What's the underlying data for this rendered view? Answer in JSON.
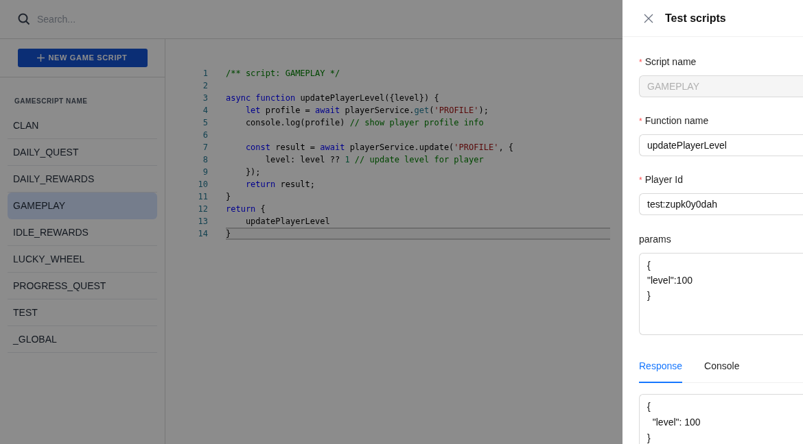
{
  "search": {
    "placeholder": "Search..."
  },
  "sidebar": {
    "new_button": "NEW GAME SCRIPT",
    "heading": "GAMESCRIPT NAME",
    "items": [
      {
        "label": "CLAN",
        "selected": false
      },
      {
        "label": "DAILY_QUEST",
        "selected": false
      },
      {
        "label": "DAILY_REWARDS",
        "selected": false
      },
      {
        "label": "GAMEPLAY",
        "selected": true
      },
      {
        "label": "IDLE_REWARDS",
        "selected": false
      },
      {
        "label": "LUCKY_WHEEL",
        "selected": false
      },
      {
        "label": "PROGRESS_QUEST",
        "selected": false
      },
      {
        "label": "TEST",
        "selected": false
      },
      {
        "label": "_GLOBAL",
        "selected": false
      }
    ]
  },
  "editor": {
    "lines": [
      {
        "number": "1",
        "current": false,
        "tokens": [
          {
            "text": "/** script: GAMEPLAY */",
            "kind": "comment"
          }
        ]
      },
      {
        "number": "2",
        "current": false
      },
      {
        "number": "3",
        "current": false,
        "tokens": [
          {
            "text": "async function",
            "kind": "keyword"
          },
          {
            "text": " updatePlayerLevel({level}) {",
            "kind": "plain"
          }
        ]
      },
      {
        "number": "4",
        "current": false,
        "tokens": [
          {
            "text": "    let",
            "kind": "keyword"
          },
          {
            "text": " profile = ",
            "kind": "plain"
          },
          {
            "text": "await",
            "kind": "keyword"
          },
          {
            "text": " playerService.",
            "kind": "plain"
          },
          {
            "text": "get",
            "kind": "method"
          },
          {
            "text": "(",
            "kind": "plain"
          },
          {
            "text": "'PROFILE'",
            "kind": "string"
          },
          {
            "text": ");",
            "kind": "plain"
          }
        ]
      },
      {
        "number": "5",
        "current": false,
        "tokens": [
          {
            "text": "    console.log(profile) ",
            "kind": "plain"
          },
          {
            "text": "// show player profile info",
            "kind": "comment"
          }
        ]
      },
      {
        "number": "6",
        "current": false
      },
      {
        "number": "7",
        "current": false,
        "tokens": [
          {
            "text": "    const",
            "kind": "keyword"
          },
          {
            "text": " result = ",
            "kind": "plain"
          },
          {
            "text": "await",
            "kind": "keyword"
          },
          {
            "text": " playerService.update(",
            "kind": "plain"
          },
          {
            "text": "'PROFILE'",
            "kind": "string"
          },
          {
            "text": ", {",
            "kind": "plain"
          }
        ]
      },
      {
        "number": "8",
        "current": false,
        "tokens": [
          {
            "text": "        level: level ?? ",
            "kind": "plain"
          },
          {
            "text": "1",
            "kind": "number"
          },
          {
            "text": " // update level for player",
            "kind": "comment"
          }
        ]
      },
      {
        "number": "9",
        "current": false,
        "tokens": [
          {
            "text": "    });",
            "kind": "plain"
          }
        ]
      },
      {
        "number": "10",
        "current": false,
        "tokens": [
          {
            "text": "    return",
            "kind": "keyword"
          },
          {
            "text": " result;",
            "kind": "plain"
          }
        ]
      },
      {
        "number": "11",
        "current": false,
        "tokens": [
          {
            "text": "}",
            "kind": "plain"
          }
        ]
      },
      {
        "number": "12",
        "current": false,
        "tokens": [
          {
            "text": "return",
            "kind": "keyword"
          },
          {
            "text": " {",
            "kind": "plain"
          }
        ]
      },
      {
        "number": "13",
        "current": false,
        "tokens": [
          {
            "text": "    updatePlayerLevel",
            "kind": "plain"
          }
        ]
      },
      {
        "number": "14",
        "current": true,
        "tokens": [
          {
            "text": "}",
            "kind": "plain"
          }
        ]
      }
    ]
  },
  "drawer": {
    "title": "Test scripts",
    "fields": [
      {
        "label": "Script name",
        "required_mark": "*",
        "value": "GAMEPLAY",
        "disabled": true
      },
      {
        "label": "Function name",
        "required_mark": "*",
        "value": "updatePlayerLevel",
        "disabled": false
      },
      {
        "label": "Player Id",
        "required_mark": "*",
        "value": "test:zupk0y0dah",
        "disabled": false
      }
    ],
    "params": {
      "label": "params",
      "lines": [
        "{",
        "\"level\":100",
        "}"
      ]
    },
    "tabs": [
      {
        "label": "Response",
        "selected": true
      },
      {
        "label": "Console",
        "selected": false
      }
    ],
    "response": {
      "lines": [
        "{",
        "  \"level\": 100",
        "}"
      ]
    }
  }
}
